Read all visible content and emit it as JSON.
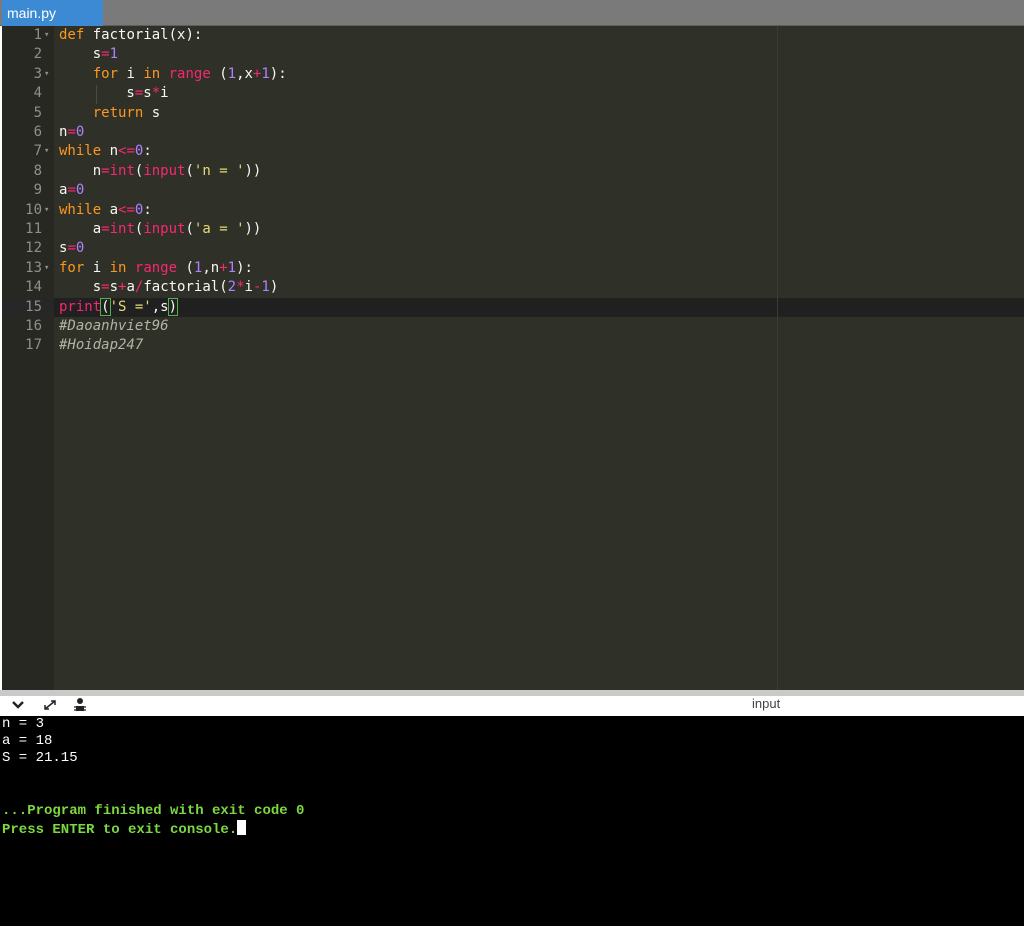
{
  "tab": {
    "label": "main.py"
  },
  "editor": {
    "line_numbers": [
      "1",
      "2",
      "3",
      "4",
      "5",
      "6",
      "7",
      "8",
      "9",
      "10",
      "11",
      "12",
      "13",
      "14",
      "15",
      "16",
      "17"
    ],
    "comments": [
      "#Daoanhviet96",
      "#Hoidap247"
    ]
  },
  "console": {
    "input_label": "input",
    "output": [
      "n = 3",
      "a = 18",
      "S = 21.15"
    ],
    "finished": "...Program finished with exit code 0",
    "press_enter": "Press ENTER to exit console."
  },
  "icons": {
    "collapse": "chevron-down-icon",
    "expand": "expand-arrows-icon",
    "debug": "debug-icon"
  }
}
